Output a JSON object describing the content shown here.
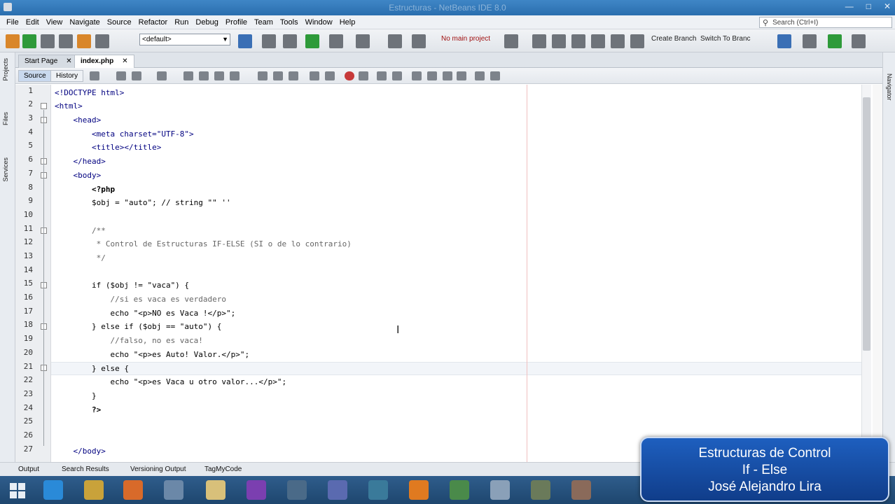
{
  "window": {
    "title": "Estructuras - NetBeans IDE 8.0"
  },
  "menu": [
    "File",
    "Edit",
    "View",
    "Navigate",
    "Source",
    "Refactor",
    "Run",
    "Debug",
    "Profile",
    "Team",
    "Tools",
    "Window",
    "Help"
  ],
  "search": {
    "placeholder": "Search (Ctrl+I)"
  },
  "toolbar": {
    "config": "<default>",
    "project_status": "No main project",
    "create_branch": "Create Branch",
    "switch_branch": "Switch To Branc"
  },
  "left_tabs": [
    "Projects",
    "Files",
    "Services"
  ],
  "right_tabs": [
    "Navigator"
  ],
  "file_tabs": [
    {
      "label": "Start Page",
      "active": false
    },
    {
      "label": "index.php",
      "active": true
    }
  ],
  "editor_tabs": [
    "Source",
    "History"
  ],
  "line_numbers": [
    "1",
    "2",
    "3",
    "4",
    "5",
    "6",
    "7",
    "8",
    "9",
    "10",
    "11",
    "12",
    "13",
    "14",
    "15",
    "16",
    "17",
    "18",
    "19",
    "20",
    "21",
    "22",
    "23",
    "24",
    "25",
    "26",
    "27"
  ],
  "code_lines": [
    "<!DOCTYPE html>",
    "<html>",
    "    <head>",
    "        <meta charset=\"UTF-8\">",
    "        <title></title>",
    "    </head>",
    "    <body>",
    "        <?php",
    "        $obj = \"auto\"; // string \"\" ''",
    "",
    "        /**",
    "         * Control de Estructuras IF-ELSE (SI o de lo contrario)",
    "         */",
    "",
    "        if ($obj != \"vaca\") {",
    "            //si es vaca es verdadero",
    "            echo \"<p>NO es Vaca !</p>\";",
    "        } else if ($obj == \"auto\") {",
    "            //falso, no es vaca!",
    "            echo \"<p>es Auto! Valor.</p>\";",
    "        } else {",
    "            echo \"<p>es Vaca u otro valor...</p>\";",
    "        }",
    "        ?>",
    "",
    "",
    "    </body>"
  ],
  "status": {
    "output": "Output",
    "search_results": "Search Results",
    "versioning": "Versioning Output",
    "tagmycode": "TagMyCode"
  },
  "overlay": {
    "line1": "Estructuras de Control",
    "line2": "If - Else",
    "line3": "José Alejandro Lira"
  }
}
